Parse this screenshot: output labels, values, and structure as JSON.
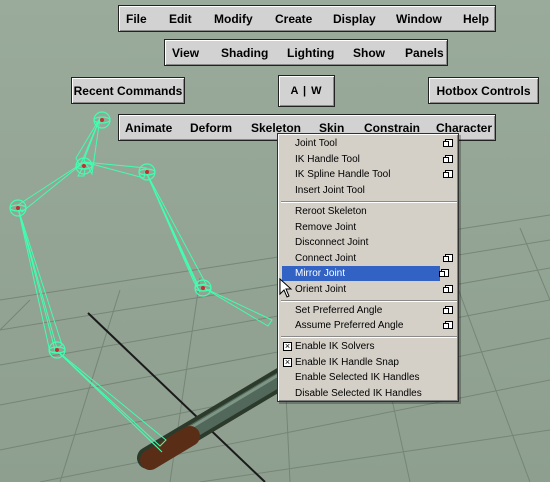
{
  "menubar": {
    "items": [
      "File",
      "Edit",
      "Modify",
      "Create",
      "Display",
      "Window",
      "Help"
    ]
  },
  "viewbar": {
    "items": [
      "View",
      "Shading",
      "Lighting",
      "Show",
      "Panels"
    ]
  },
  "hotbox": {
    "recent_commands": "Recent Commands",
    "aw": "A | W",
    "hotbox_controls": "Hotbox Controls"
  },
  "modebar": {
    "items": [
      "Animate",
      "Deform",
      "Skeleton",
      "Skin",
      "Constrain",
      "Character"
    ]
  },
  "skeleton_menu": {
    "items": [
      {
        "label": "Joint Tool",
        "option": true
      },
      {
        "label": "IK Handle Tool",
        "option": true
      },
      {
        "label": "IK Spline Handle Tool",
        "option": true
      },
      {
        "label": "Insert Joint Tool",
        "option": false
      },
      {
        "label": "Reroot Skeleton",
        "option": false
      },
      {
        "label": "Remove Joint",
        "option": false
      },
      {
        "label": "Disconnect Joint",
        "option": false
      },
      {
        "label": "Connect Joint",
        "option": true
      },
      {
        "label": "Mirror Joint",
        "option": true,
        "highlighted": true
      },
      {
        "label": "Orient Joint",
        "option": true
      },
      {
        "label": "Set Preferred Angle",
        "option": true
      },
      {
        "label": "Assume Preferred Angle",
        "option": true
      },
      {
        "label": "Enable IK Solvers",
        "checkbox": true,
        "checked": true
      },
      {
        "label": "Enable IK Handle Snap",
        "checkbox": true,
        "checked": true
      },
      {
        "label": "Enable Selected IK Handles",
        "option": false
      },
      {
        "label": "Disable Selected IK Handles",
        "option": false
      }
    ]
  },
  "colors": {
    "highlight": "#3162c4",
    "joint": "#40ffb0",
    "viewport": "#94a595"
  }
}
